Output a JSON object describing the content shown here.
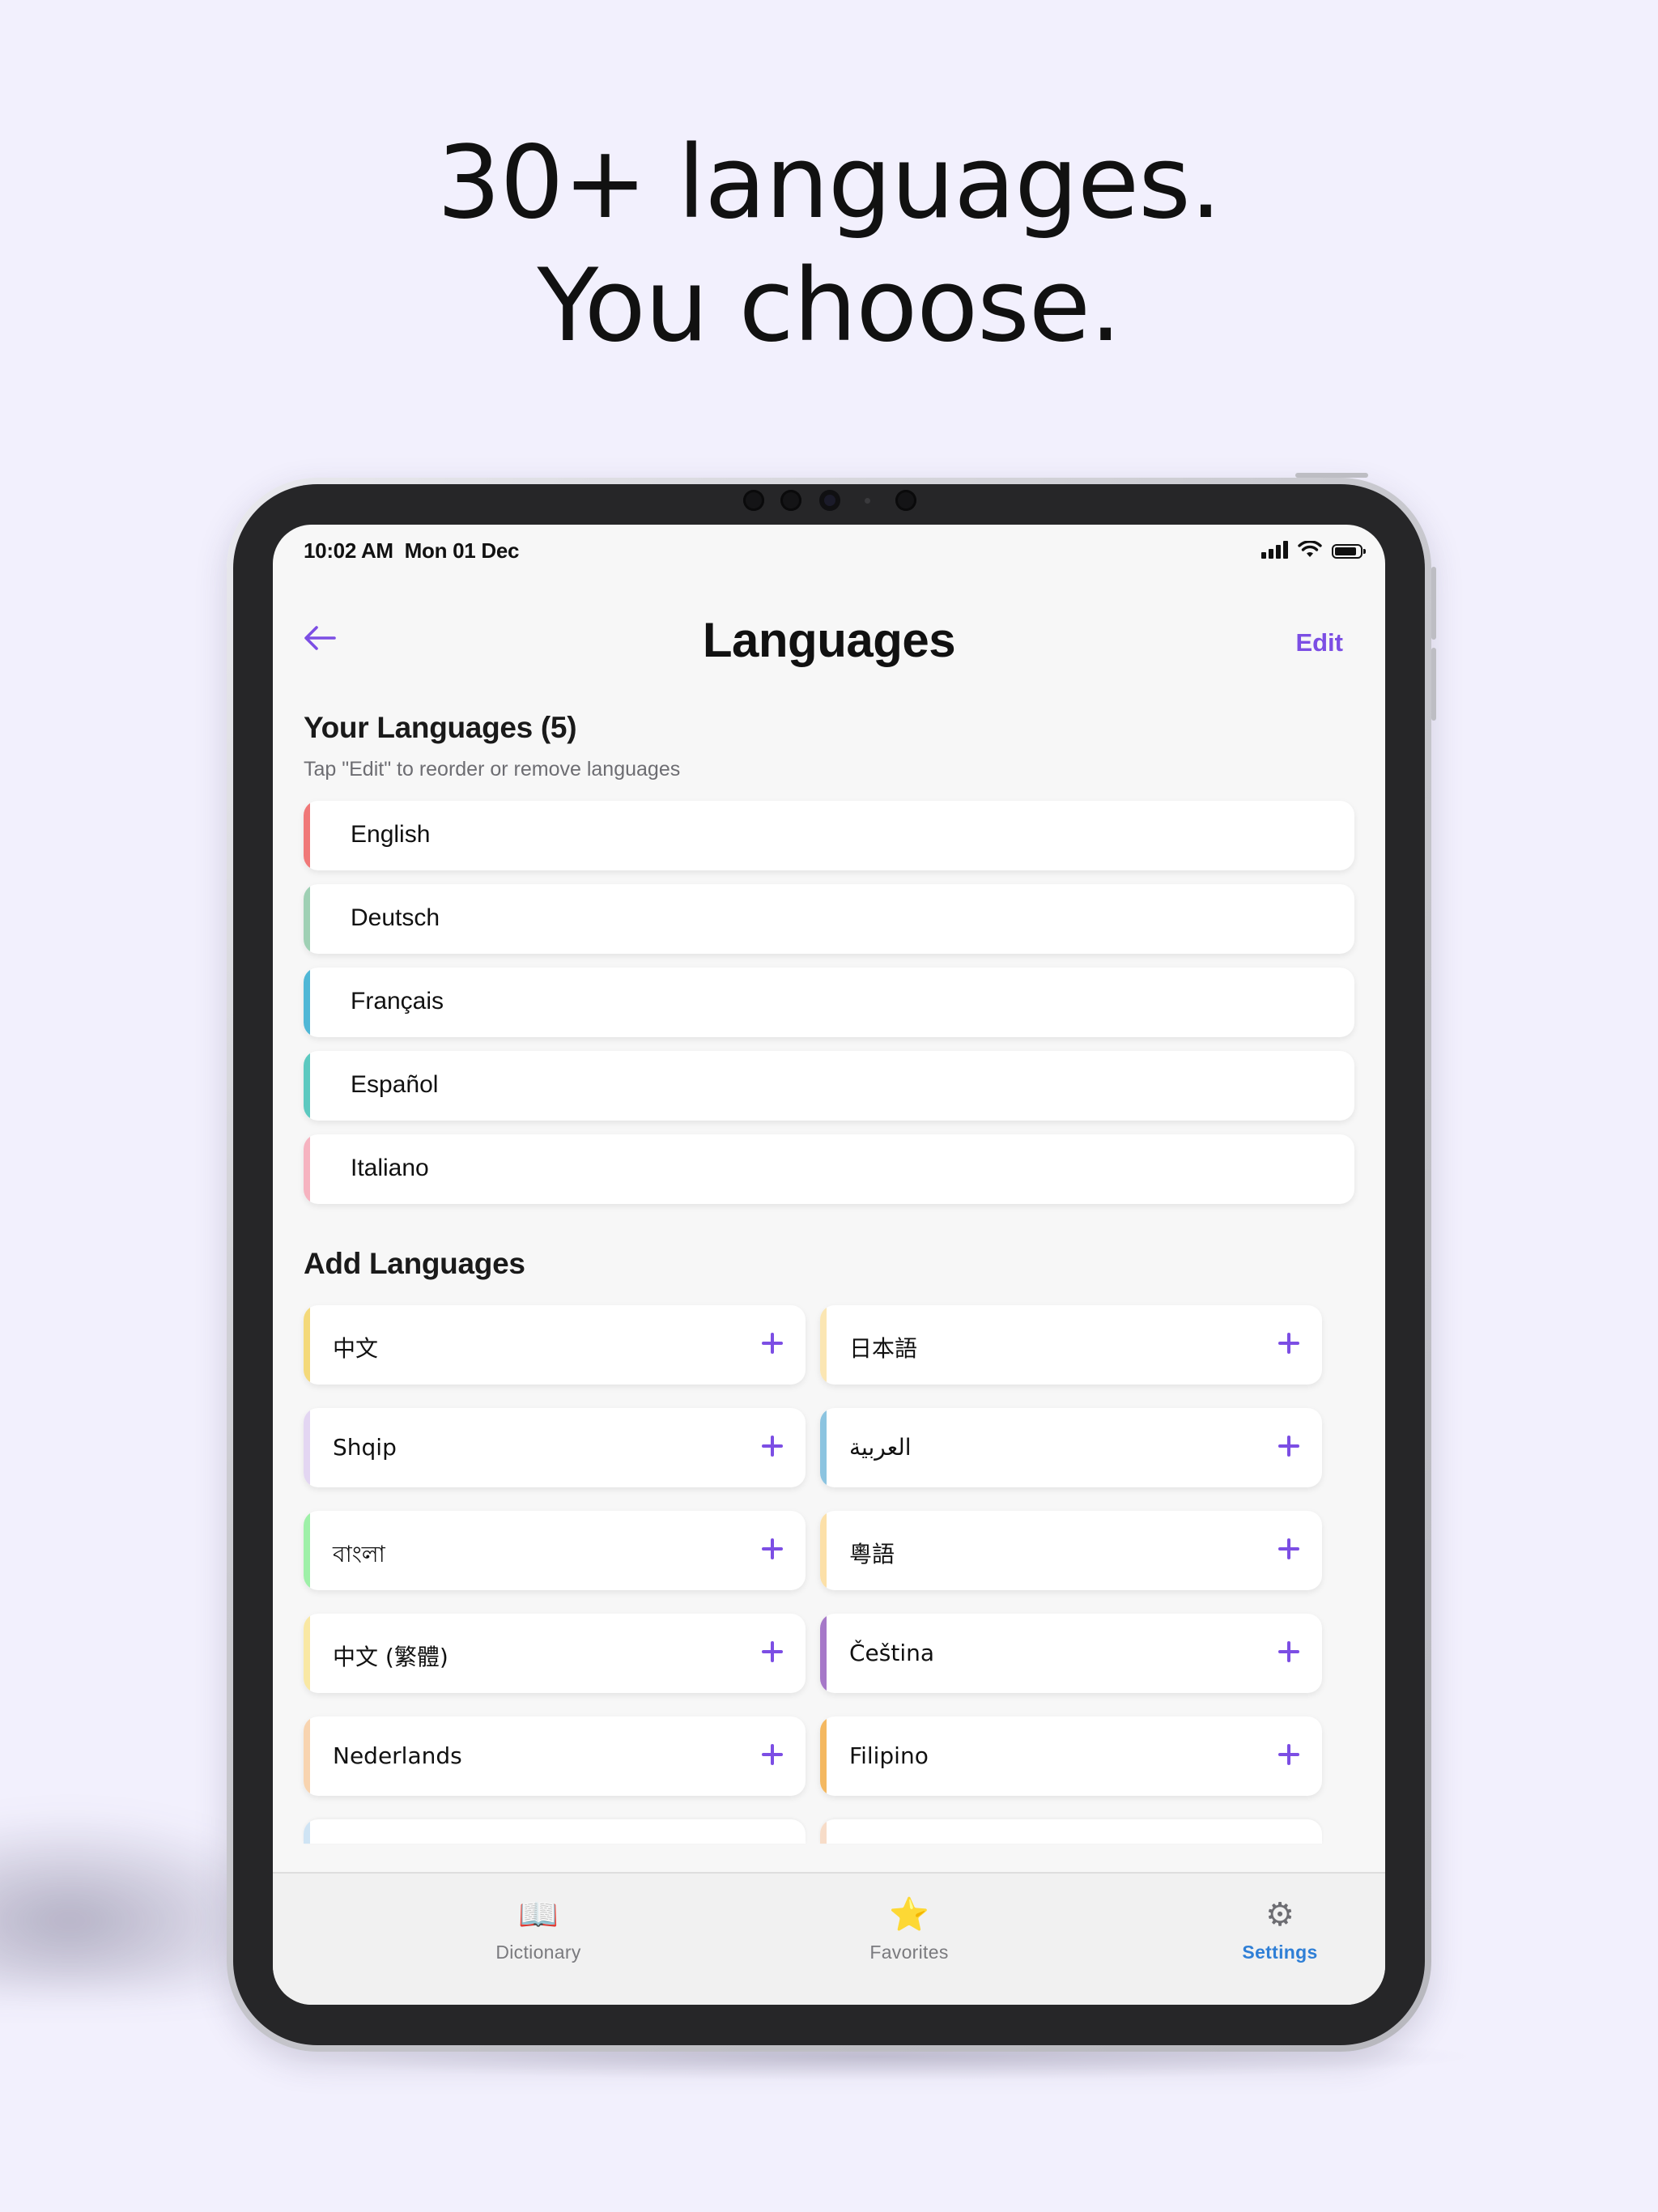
{
  "marketing": {
    "headline_line1": "30+ languages.",
    "headline_line2": "You choose."
  },
  "status_bar": {
    "time": "10:02 AM",
    "date": "Mon 01 Dec"
  },
  "nav": {
    "title": "Languages",
    "edit_label": "Edit"
  },
  "your_languages": {
    "title": "Your Languages (5)",
    "subtitle": "Tap \"Edit\" to reorder or remove languages",
    "items": [
      {
        "label": "English",
        "accent": "#f07878"
      },
      {
        "label": "Deutsch",
        "accent": "#9fd0b4"
      },
      {
        "label": "Français",
        "accent": "#4fb7d6"
      },
      {
        "label": "Español",
        "accent": "#5cc9c0"
      },
      {
        "label": "Italiano",
        "accent": "#f6b3c0"
      }
    ]
  },
  "add_languages": {
    "title": "Add Languages",
    "items": [
      {
        "label": "中文",
        "accent": "#f4d97a"
      },
      {
        "label": "日本語",
        "accent": "#fbe6b3"
      },
      {
        "label": "Shqip",
        "accent": "#e3d6f2"
      },
      {
        "label": "العربية",
        "accent": "#8cc4e0"
      },
      {
        "label": "বাংলা",
        "accent": "#9ef0a8"
      },
      {
        "label": "粵語",
        "accent": "#fce0a8"
      },
      {
        "label": "中文 (繁體)",
        "accent": "#f9e8a4"
      },
      {
        "label": "Čeština",
        "accent": "#a678c8"
      },
      {
        "label": "Nederlands",
        "accent": "#f8d4b0"
      },
      {
        "label": "Filipino",
        "accent": "#f4b860"
      }
    ],
    "peek_accents": [
      "#cfe4f4",
      "#f7dcc8"
    ]
  },
  "tabbar": {
    "tabs": [
      {
        "label": "Dictionary",
        "icon": "book-icon",
        "glyph": "📖",
        "active": false
      },
      {
        "label": "Favorites",
        "icon": "star-icon",
        "glyph": "⭐",
        "active": false
      },
      {
        "label": "Settings",
        "icon": "gear-icon",
        "glyph": "⚙",
        "active": true
      }
    ],
    "active_color": "#2f7fd6"
  },
  "colors": {
    "accent": "#7c4ee4",
    "background": "#f2f0fd"
  }
}
